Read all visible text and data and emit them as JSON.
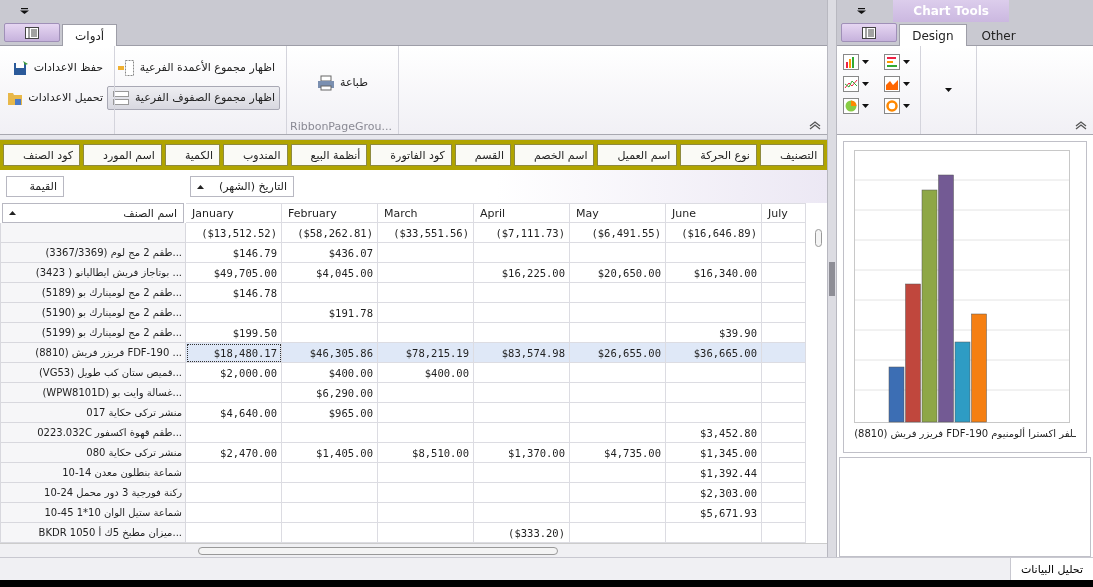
{
  "left_ribbon": {
    "tabs": [
      {
        "label": "أدوات",
        "selected": true
      }
    ],
    "groups": [
      {
        "caption": "RibbonPageGrou...",
        "buttons": [
          {
            "label": "طباعة",
            "kind": "print",
            "pressed": false
          }
        ]
      },
      {
        "buttons": [
          {
            "label": "اظهار مجموع الأعمدة الفرعية",
            "kind": "columns",
            "pressed": false
          },
          {
            "label": "اظهار مجموع الصفوف الفرعية",
            "kind": "rows",
            "pressed": true
          }
        ]
      },
      {
        "buttons": [
          {
            "label": "حفظ الاعدادات",
            "kind": "save",
            "pressed": false
          },
          {
            "label": "تحميل الاعدادات",
            "kind": "load",
            "pressed": false
          }
        ]
      }
    ]
  },
  "filter_fields": [
    "التصنيف",
    "نوع الحركة",
    "اسم العميل",
    "اسم الخصم",
    "القسم",
    "كود الفاتورة",
    "أنظمة البيع",
    "المندوب",
    "الكمية",
    "اسم المورد",
    "كود الصنف"
  ],
  "data_field": "القيمة",
  "column_field": "التاريخ (الشهر)",
  "row_field": "اسم الصنف",
  "columns": [
    "July",
    "June",
    "May",
    "April",
    "March",
    "February",
    "January"
  ],
  "totals": {
    "june": "($16,646.89)",
    "may": "($6,491.55)",
    "april": "($7,111.73)",
    "march": "($33,551.56)",
    "february": "($58,262.81)",
    "january": "($13,512.52)"
  },
  "rows": [
    {
      "label": "...طقم 2 مج لوم (3367/3369)",
      "selected": false,
      "values": {
        "february": "$436.07",
        "january": "$146.79"
      }
    },
    {
      "label": "... بوتاجاز فريش ايطاليانو ( 3423)",
      "selected": false,
      "values": {
        "june": "$16,340.00",
        "may": "$20,650.00",
        "april": "$16,225.00",
        "february": "$4,045.00",
        "january": "$49,705.00"
      }
    },
    {
      "label": "...طقم 2 مج لومينارك بو (5189)",
      "selected": false,
      "values": {
        "january": "$146.78"
      }
    },
    {
      "label": "...طقم 2 مج لومينارك بو (5190)",
      "selected": false,
      "values": {
        "february": "$191.78"
      }
    },
    {
      "label": "...طقم 2 مج لومينارك بو (5199)",
      "selected": false,
      "values": {
        "june": "$39.90",
        "january": "$199.50"
      }
    },
    {
      "label": "... FDF-190 فريزر فريش (8810)",
      "selected": true,
      "values": {
        "june": "$36,665.00",
        "may": "$26,655.00",
        "april": "$83,574.98",
        "march": "$78,215.19",
        "february": "$46,305.86",
        "january": "$18,480.17"
      }
    },
    {
      "label": "...قميص ستان كب طويل (VG53)",
      "selected": false,
      "values": {
        "march": "$400.00",
        "february": "$400.00",
        "january": "$2,000.00"
      }
    },
    {
      "label": "...غسالة وايت بو (WPW8101D)",
      "selected": false,
      "values": {
        "february": "$6,290.00"
      }
    },
    {
      "label": "منشر تركى حكاية 017",
      "selected": false,
      "values": {
        "february": "$965.00",
        "january": "$4,640.00"
      }
    },
    {
      "label": "...طقم قهوة اكسفور 0223.032C",
      "selected": false,
      "values": {
        "june": "$3,452.80"
      }
    },
    {
      "label": "منشر تركى حكاية 080",
      "selected": false,
      "values": {
        "june": "$1,345.00",
        "may": "$4,735.00",
        "april": "$1,370.00",
        "march": "$8,510.00",
        "february": "$1,405.00",
        "january": "$2,470.00"
      }
    },
    {
      "label": "شماعة بنطلون معدن 14-10",
      "selected": false,
      "values": {
        "june": "$1,392.44"
      }
    },
    {
      "label": "ركنة فورجية 3 دور محمل 24-10",
      "selected": false,
      "values": {
        "june": "$2,303.00"
      }
    },
    {
      "label": "شماعة ستيل الوان 10*1 45-10",
      "selected": false,
      "values": {
        "june": "$5,671.93"
      }
    },
    {
      "label": "...ميزان مطبخ 5ك أ BKDR 1050",
      "selected": false,
      "values": {
        "april": "($333.20)"
      }
    }
  ],
  "right_ribbon": {
    "context_title": "Chart Tools",
    "tabs": [
      {
        "label": "Other",
        "selected": false
      },
      {
        "label": "Design",
        "selected": true
      }
    ],
    "chart_types": [
      {
        "kind": "hbar"
      },
      {
        "kind": "bar"
      },
      {
        "kind": "area"
      },
      {
        "kind": "line"
      },
      {
        "kind": "donut"
      },
      {
        "kind": "pie"
      }
    ]
  },
  "chart": {
    "category_label": "ـلفر اكسترا ألومنيوم FDF-190 فريزر فريش (8810)"
  },
  "status_tabs": [
    {
      "label": "تحليل البيانات",
      "selected": true
    }
  ]
}
